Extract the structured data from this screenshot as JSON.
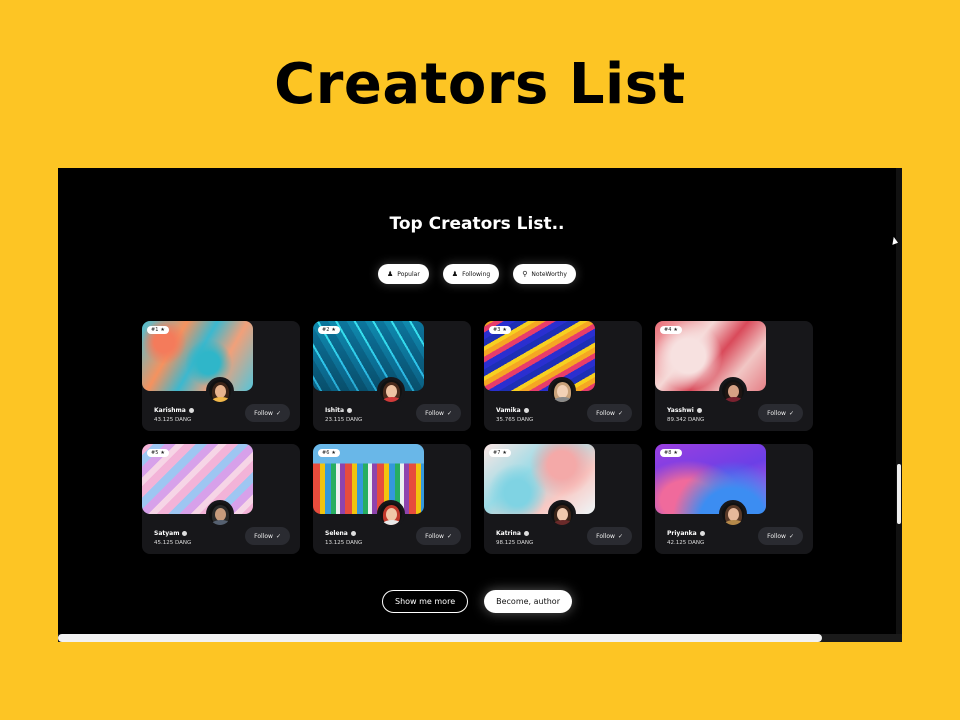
{
  "slide": {
    "title": "Creators List"
  },
  "page": {
    "heading": "Top Creators List..",
    "filters": [
      {
        "label": "Popular",
        "icon": "person-icon"
      },
      {
        "label": "Following",
        "icon": "person-icon"
      },
      {
        "label": "NoteWorthy",
        "icon": "pin-icon"
      }
    ],
    "creators": [
      {
        "rank": "#1",
        "name": "Karishma",
        "amount": "43.125 DANG",
        "follow": "Follow"
      },
      {
        "rank": "#2",
        "name": "Ishita",
        "amount": "23.115 DANG",
        "follow": "Follow"
      },
      {
        "rank": "#3",
        "name": "Vamika",
        "amount": "35.765 DANG",
        "follow": "Follow"
      },
      {
        "rank": "#4",
        "name": "Yasshwi",
        "amount": "89.342 DANG",
        "follow": "Follow"
      },
      {
        "rank": "#5",
        "name": "Satyam",
        "amount": "45.125 DANG",
        "follow": "Follow"
      },
      {
        "rank": "#6",
        "name": "Selena",
        "amount": "13.125 DANG",
        "follow": "Follow"
      },
      {
        "rank": "#7",
        "name": "Katrina",
        "amount": "98.125 DANG",
        "follow": "Follow"
      },
      {
        "rank": "#8",
        "name": "Priyanka",
        "amount": "42.125 DANG",
        "follow": "Follow"
      }
    ],
    "actions": {
      "show_more": "Show me more",
      "become_author": "Become, author"
    }
  },
  "colors": {
    "background": "#FDC524",
    "screen": "#000000",
    "card": "#17171a"
  }
}
